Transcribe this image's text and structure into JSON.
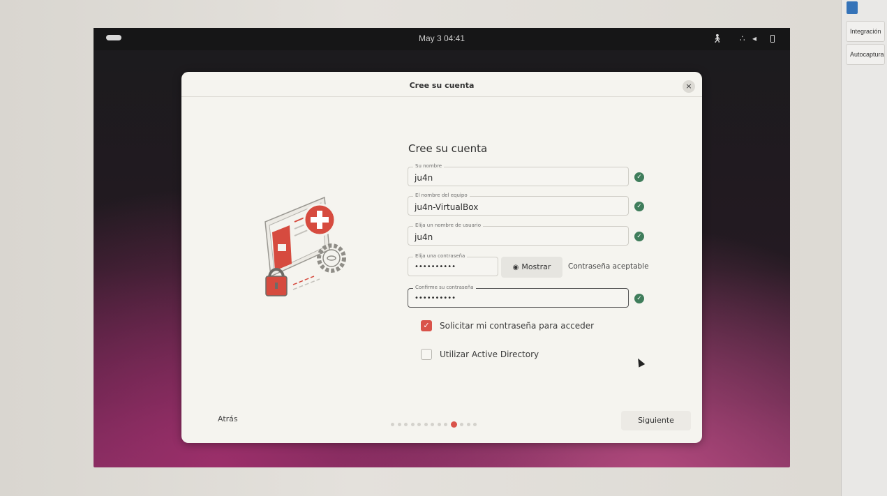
{
  "host": {
    "side_buttons": [
      "Integración",
      "Autocaptura"
    ]
  },
  "topbar": {
    "clock": "May 3  04:41",
    "tray_icons": [
      "accessibility-icon",
      "network-icon",
      "volume-icon",
      "battery-icon"
    ]
  },
  "dialog": {
    "title": "Cree su cuenta",
    "close_symbol": "×",
    "heading": "Cree su cuenta",
    "fields": {
      "name": {
        "label": "Su nombre",
        "value": "ju4n"
      },
      "computer": {
        "label": "El nombre del equipo",
        "value": "ju4n-VirtualBox"
      },
      "username": {
        "label": "Elija un nombre de usuario",
        "value": "ju4n"
      },
      "password": {
        "label": "Elija una contraseña",
        "value": "••••••••••"
      },
      "confirm": {
        "label": "Confirme su contraseña",
        "value": "••••••••••"
      }
    },
    "show_button": "Mostrar",
    "password_strength": "Contraseña aceptable",
    "checkboxes": {
      "require_password": {
        "label": "Solicitar mi contraseña para acceder",
        "checked": true
      },
      "active_directory": {
        "label": "Utilizar Active Directory",
        "checked": false
      }
    },
    "back_button": "Atrás",
    "next_button": "Siguiente",
    "steps": {
      "total": 13,
      "current": 10
    }
  },
  "colors": {
    "accent": "#d9534a",
    "success": "#3f7d5b",
    "dialog_bg": "#f5f4ef"
  }
}
